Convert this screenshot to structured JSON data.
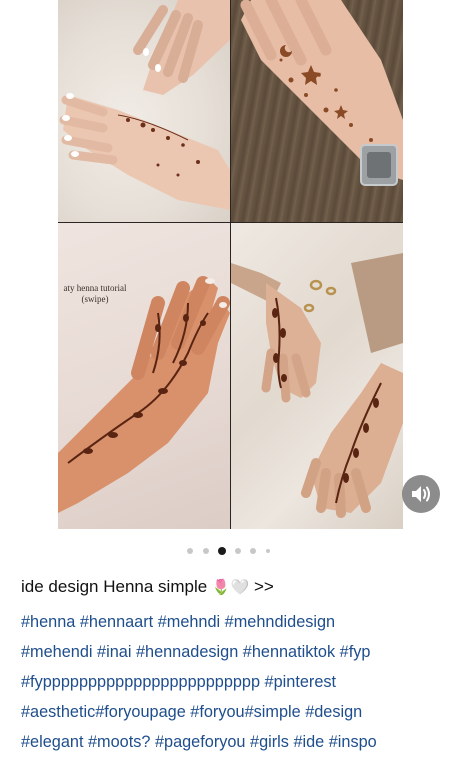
{
  "post": {
    "image_caption": "aty henna tutorial\n(swipe)",
    "carousel_count": 6,
    "carousel_active_index": 2,
    "description": "ide design Henna simple",
    "description_emojis": "🌷🤍",
    "description_more": ">>",
    "hashtag_lines": [
      "#henna #hennaart #mehndi #mehndidesign",
      "#mehendi #inai  #hennadesign #hennatiktok #fyp",
      "#fypppppppppppppppppppppppp #pinterest",
      "#aesthetic#foryoupage #foryou#simple #design",
      "#elegant #moots? #pageforyou #girls #ide #inspo"
    ]
  },
  "icons": {
    "sound": "speaker-icon"
  },
  "colors": {
    "hashtag": "#1f4e8c",
    "text": "#111111",
    "dot_active": "#1a1a1a",
    "dot_inactive": "#c8c8c8",
    "henna": "#6b2f1a"
  }
}
